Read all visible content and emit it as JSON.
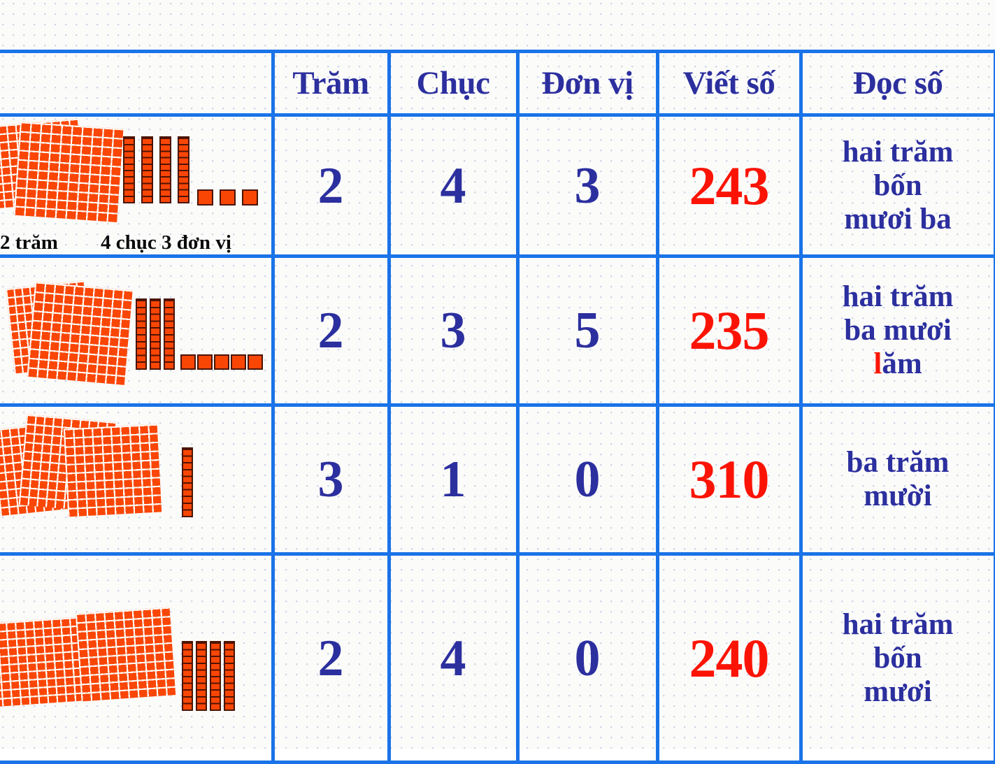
{
  "table": {
    "headers": [
      {
        "key": "blocks",
        "label": ""
      },
      {
        "key": "tram",
        "label": "Trăm"
      },
      {
        "key": "chuc",
        "label": "Chục"
      },
      {
        "key": "donvi",
        "label": "Đơn vị"
      },
      {
        "key": "viet",
        "label": "Viết số"
      },
      {
        "key": "doc",
        "label": "Đọc số"
      }
    ],
    "rows": [
      {
        "blocks": {
          "flats": 2,
          "rods": 4,
          "units": 3
        },
        "labels": {
          "hundreds": "2 trăm",
          "tens_units": "4 chục 3 đơn vị"
        },
        "tram": "2",
        "chuc": "4",
        "donvi": "3",
        "viet": "243",
        "doc_line1": "hai trăm",
        "doc_line2": "bốn",
        "doc_line3": "mươi ba"
      },
      {
        "blocks": {
          "flats": 2,
          "rods": 3,
          "units": 5
        },
        "labels": {
          "hundreds": "",
          "tens_units": ""
        },
        "tram": "2",
        "chuc": "3",
        "donvi": "5",
        "viet": "235",
        "doc_line1": "hai trăm",
        "doc_line2": "ba mươi",
        "doc_line3_hl": "l",
        "doc_line3_rest": "ăm"
      },
      {
        "blocks": {
          "flats": 3,
          "rods": 1,
          "units": 0
        },
        "labels": {
          "hundreds": "",
          "tens_units": ""
        },
        "tram": "3",
        "chuc": "1",
        "donvi": "0",
        "viet": "310",
        "doc_line1": "ba trăm",
        "doc_line2": "mười"
      },
      {
        "blocks": {
          "flats": 2,
          "rods": 4,
          "units": 0
        },
        "labels": {
          "hundreds": "",
          "tens_units": ""
        },
        "tram": "2",
        "chuc": "4",
        "donvi": "0",
        "viet": "240",
        "doc_line1": "hai trăm",
        "doc_line2": "bốn",
        "doc_line3": "mươi"
      }
    ]
  },
  "colors": {
    "border_blue": "#1a73e8",
    "text_navy": "#2c2f9e",
    "number_red": "#fb1405",
    "block_orange": "#fa4605",
    "background": "#fbfbfa"
  }
}
